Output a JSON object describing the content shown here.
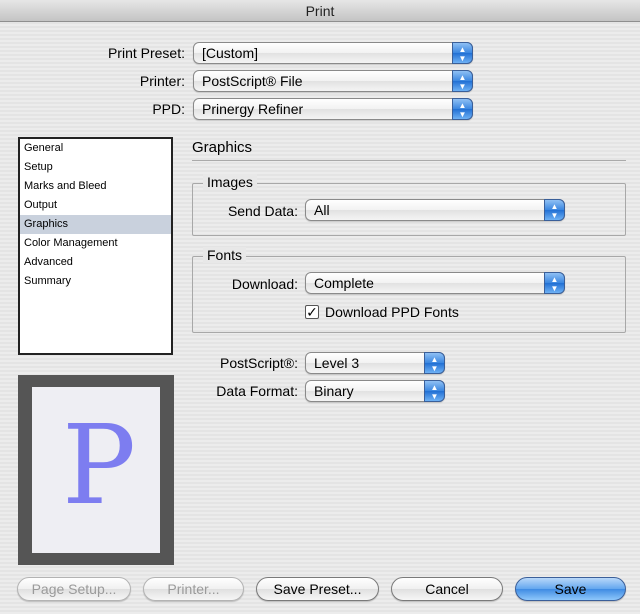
{
  "window": {
    "title": "Print"
  },
  "header": {
    "print_preset_label": "Print Preset:",
    "print_preset_value": "[Custom]",
    "printer_label": "Printer:",
    "printer_value": "PostScript® File",
    "ppd_label": "PPD:",
    "ppd_value": "Prinergy Refiner"
  },
  "sidebar": {
    "items": [
      {
        "label": "General"
      },
      {
        "label": "Setup"
      },
      {
        "label": "Marks and Bleed"
      },
      {
        "label": "Output"
      },
      {
        "label": "Graphics"
      },
      {
        "label": "Color Management"
      },
      {
        "label": "Advanced"
      },
      {
        "label": "Summary"
      }
    ],
    "selected": "Graphics"
  },
  "main": {
    "section_title": "Graphics",
    "images": {
      "group_title": "Images",
      "send_data_label": "Send Data:",
      "send_data_value": "All"
    },
    "fonts": {
      "group_title": "Fonts",
      "download_label": "Download:",
      "download_value": "Complete",
      "download_ppd_fonts_label": "Download PPD Fonts",
      "download_ppd_fonts_checked": true,
      "checkmark": "✓"
    },
    "postscript_label": "PostScript®:",
    "postscript_value": "Level 3",
    "data_format_label": "Data Format:",
    "data_format_value": "Binary"
  },
  "preview": {
    "glyph": "P",
    "glyph_color": "#7d7df0"
  },
  "footer": {
    "page_setup_label": "Page Setup...",
    "printer_label": "Printer...",
    "save_preset_label": "Save Preset...",
    "cancel_label": "Cancel",
    "save_label": "Save"
  },
  "icons": {
    "popup_arrows": "popup-arrows-icon",
    "arrow_up": "▲",
    "arrow_down": "▼"
  },
  "colors": {
    "accent": "#3a86e0",
    "selection": "#c9d1dd"
  }
}
